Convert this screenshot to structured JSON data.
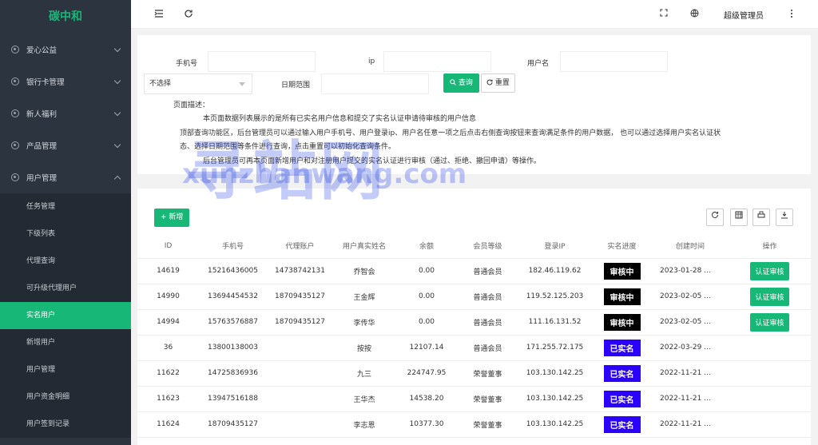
{
  "brand": "碳中和",
  "sidebar": {
    "menus": [
      {
        "label": "爱心公益"
      },
      {
        "label": "银行卡管理"
      },
      {
        "label": "新人福利"
      },
      {
        "label": "产品管理"
      },
      {
        "label": "用户管理"
      }
    ],
    "submenu": [
      {
        "label": "任务管理"
      },
      {
        "label": "下级列表"
      },
      {
        "label": "代理查询"
      },
      {
        "label": "可升级代理用户"
      },
      {
        "label": "实名用户"
      },
      {
        "label": "新增用户"
      },
      {
        "label": "用户管理"
      },
      {
        "label": "用户资金明细"
      },
      {
        "label": "用户签到记录"
      }
    ]
  },
  "topbar": {
    "admin_name": "超级管理员"
  },
  "search": {
    "phone_label": "手机号",
    "ip_label": "ip",
    "username_label": "用户名",
    "select_value": "不选择",
    "date_label": "日期范围",
    "query_label": "查询",
    "reset_label": "重置",
    "desc_title": "页面描述：",
    "desc_lines": [
      "本页面数据列表展示的是所有已实名用户信息和提交了实名认证申请待审核的用户信息",
      "顶部查询功能区，后台管理员可以通过输入用户手机号、用户登录ip、用户名任意一项之后点击右侧查询按钮来查询满足条件的用户数据，  也可以通过选择用户实名认证状",
      "态、选择日期范围等条件进行查询，点击重置可以初始化查询条件。",
      "后台管理员可再本页面新增用户和对注册用户提交的实名认证进行审核（通过、拒绝、撤回申请）等操作。"
    ]
  },
  "table": {
    "add_label": "新增",
    "columns": [
      "ID",
      "手机号",
      "代理账户",
      "用户真实姓名",
      "余额",
      "会员等级",
      "登录IP",
      "实名进度",
      "创建时间",
      "操作"
    ],
    "rows": [
      {
        "id": "14619",
        "phone": "15216436005",
        "agent": "14738742131",
        "name": "乔智会",
        "balance": "0.00",
        "level": "普通会员",
        "ip": "182.46.119.62",
        "status": "审核中",
        "created": "2023-01-28 ...",
        "action": "认证审核"
      },
      {
        "id": "14990",
        "phone": "13694454532",
        "agent": "18709435127",
        "name": "王金辉",
        "balance": "0.00",
        "level": "普通会员",
        "ip": "119.52.125.203",
        "status": "审核中",
        "created": "2023-02-05 ...",
        "action": "认证审核"
      },
      {
        "id": "14994",
        "phone": "15763576887",
        "agent": "18709435127",
        "name": "李传华",
        "balance": "0.00",
        "level": "普通会员",
        "ip": "111.16.131.52",
        "status": "审核中",
        "created": "2023-02-05 ...",
        "action": "认证审核"
      },
      {
        "id": "36",
        "phone": "13800138003",
        "agent": "",
        "name": "按按",
        "balance": "12107.14",
        "level": "普通会员",
        "ip": "171.255.72.175",
        "status": "已实名",
        "created": "2022-03-29 ...",
        "action": ""
      },
      {
        "id": "11622",
        "phone": "14725836936",
        "agent": "",
        "name": "九三",
        "balance": "224747.95",
        "level": "荣誉董事",
        "ip": "103.130.142.25",
        "status": "已实名",
        "created": "2022-11-21 ...",
        "action": ""
      },
      {
        "id": "11623",
        "phone": "13947516188",
        "agent": "",
        "name": "王华杰",
        "balance": "14538.20",
        "level": "荣誉董事",
        "ip": "103.130.142.25",
        "status": "已实名",
        "created": "2022-11-21 ...",
        "action": ""
      },
      {
        "id": "11624",
        "phone": "18709435127",
        "agent": "",
        "name": "李志恩",
        "balance": "10377.30",
        "level": "荣誉董事",
        "ip": "103.130.142.25",
        "status": "已实名",
        "created": "2022-11-21 ...",
        "action": ""
      }
    ]
  },
  "watermark": {
    "big": "寻站网",
    "url": "xunzhanwang.com"
  }
}
